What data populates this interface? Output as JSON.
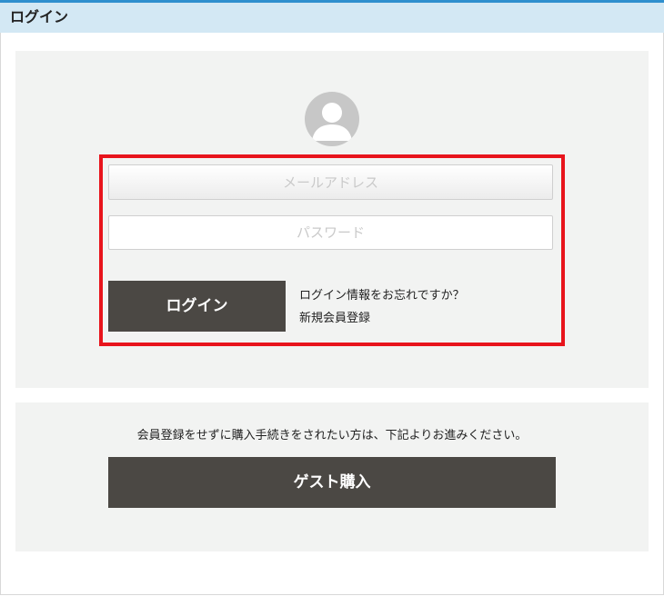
{
  "header": {
    "title": "ログイン"
  },
  "login": {
    "avatar_icon": "user-avatar-icon",
    "email_placeholder": "メールアドレス",
    "password_placeholder": "パスワード",
    "login_button": "ログイン",
    "forgot_link": "ログイン情報をお忘れですか？",
    "register_link": "新規会員登録"
  },
  "guest": {
    "note": "会員登録をせずに購入手続きをされたい方は、下記よりお進みください。",
    "button": "ゲスト購入"
  },
  "colors": {
    "header_bg": "#d3e8f4",
    "header_accent": "#2e8fce",
    "panel_bg": "#f2f3f2",
    "button_bg": "#4b4844",
    "highlight_border": "#e8141c"
  }
}
